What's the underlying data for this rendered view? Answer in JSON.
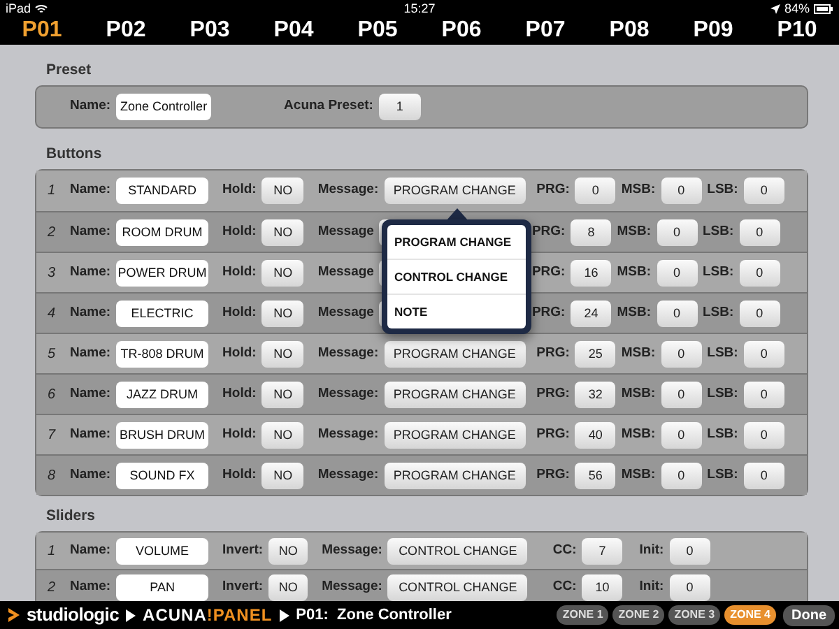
{
  "status_bar": {
    "carrier": "iPad",
    "time": "15:27",
    "battery": "84%"
  },
  "tabs": [
    {
      "label": "P01",
      "selected": true
    },
    {
      "label": "P02",
      "selected": false
    },
    {
      "label": "P03",
      "selected": false
    },
    {
      "label": "P04",
      "selected": false
    },
    {
      "label": "P05",
      "selected": false
    },
    {
      "label": "P06",
      "selected": false
    },
    {
      "label": "P07",
      "selected": false
    },
    {
      "label": "P08",
      "selected": false
    },
    {
      "label": "P09",
      "selected": false
    },
    {
      "label": "P10",
      "selected": false
    }
  ],
  "preset": {
    "heading": "Preset",
    "name_label": "Name:",
    "name": "Zone Controller",
    "acuna_label": "Acuna Preset:",
    "acuna_preset": "1"
  },
  "buttons": {
    "heading": "Buttons",
    "rows": [
      {
        "number": "1",
        "name_label": "Name:",
        "name": "STANDARD",
        "hold_label": "Hold:",
        "hold": "NO",
        "message_label": "Message:",
        "message": "PROGRAM CHANGE",
        "prg_label": "PRG:",
        "prg": "0",
        "msb_label": "MSB:",
        "msb": "0",
        "lsb_label": "LSB:",
        "lsb": "0"
      },
      {
        "number": "2",
        "name_label": "Name:",
        "name": "ROOM DRUM",
        "hold_label": "Hold:",
        "hold": "NO",
        "message_label": "Message",
        "prg_label": "PRG:",
        "prg": "8",
        "msb_label": "MSB:",
        "msb": "0",
        "lsb_label": "LSB:",
        "lsb": "0"
      },
      {
        "number": "3",
        "name_label": "Name:",
        "name": "POWER DRUM",
        "hold_label": "Hold:",
        "hold": "NO",
        "message_label": "Message",
        "prg_label": "PRG:",
        "prg": "16",
        "msb_label": "MSB:",
        "msb": "0",
        "lsb_label": "LSB:",
        "lsb": "0"
      },
      {
        "number": "4",
        "name_label": "Name:",
        "name": "ELECTRIC",
        "hold_label": "Hold:",
        "hold": "NO",
        "message_label": "Message",
        "prg_label": "PRG:",
        "prg": "24",
        "msb_label": "MSB:",
        "msb": "0",
        "lsb_label": "LSB:",
        "lsb": "0"
      },
      {
        "number": "5",
        "name_label": "Name:",
        "name": "TR-808 DRUM",
        "hold_label": "Hold:",
        "hold": "NO",
        "message_label": "Message:",
        "message": "PROGRAM CHANGE",
        "prg_label": "PRG:",
        "prg": "25",
        "msb_label": "MSB:",
        "msb": "0",
        "lsb_label": "LSB:",
        "lsb": "0"
      },
      {
        "number": "6",
        "name_label": "Name:",
        "name": "JAZZ DRUM",
        "hold_label": "Hold:",
        "hold": "NO",
        "message_label": "Message:",
        "message": "PROGRAM CHANGE",
        "prg_label": "PRG:",
        "prg": "32",
        "msb_label": "MSB:",
        "msb": "0",
        "lsb_label": "LSB:",
        "lsb": "0"
      },
      {
        "number": "7",
        "name_label": "Name:",
        "name": "BRUSH DRUM",
        "hold_label": "Hold:",
        "hold": "NO",
        "message_label": "Message:",
        "message": "PROGRAM CHANGE",
        "prg_label": "PRG:",
        "prg": "40",
        "msb_label": "MSB:",
        "msb": "0",
        "lsb_label": "LSB:",
        "lsb": "0"
      },
      {
        "number": "8",
        "name_label": "Name:",
        "name": "SOUND FX",
        "hold_label": "Hold:",
        "hold": "NO",
        "message_label": "Message:",
        "message": "PROGRAM CHANGE",
        "prg_label": "PRG:",
        "prg": "56",
        "msb_label": "MSB:",
        "msb": "0",
        "lsb_label": "LSB:",
        "lsb": "0"
      }
    ]
  },
  "message_menu": {
    "items": [
      {
        "label": "PROGRAM CHANGE"
      },
      {
        "label": "CONTROL CHANGE"
      },
      {
        "label": "NOTE"
      }
    ]
  },
  "sliders": {
    "heading": "Sliders",
    "rows": [
      {
        "number": "1",
        "name_label": "Name:",
        "name": "VOLUME",
        "invert_label": "Invert:",
        "invert": "NO",
        "message_label": "Message:",
        "message": "CONTROL CHANGE",
        "cc_label": "CC:",
        "cc": "7",
        "init_label": "Init:",
        "init": "0"
      },
      {
        "number": "2",
        "name_label": "Name:",
        "name": "PAN",
        "invert_label": "Invert:",
        "invert": "NO",
        "message_label": "Message:",
        "message": "CONTROL CHANGE",
        "cc_label": "CC:",
        "cc": "10",
        "init_label": "Init:",
        "init": "0"
      }
    ]
  },
  "footer": {
    "brand": "studiologic",
    "product_left": "ACUNA",
    "product_right": "!PANEL",
    "breadcrumb": "P01:  Zone Controller",
    "zones": [
      {
        "label": "ZONE 1",
        "selected": false
      },
      {
        "label": "ZONE 2",
        "selected": false
      },
      {
        "label": "ZONE 3",
        "selected": false
      },
      {
        "label": "ZONE 4",
        "selected": true
      }
    ],
    "done": "Done"
  }
}
